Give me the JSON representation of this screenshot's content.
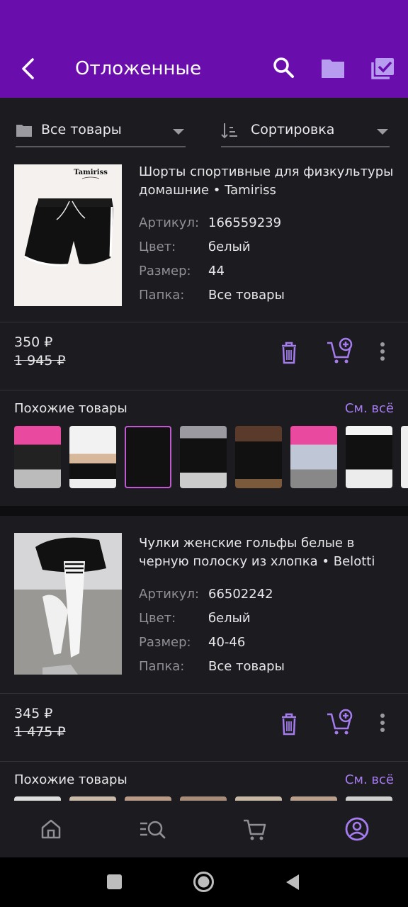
{
  "header": {
    "title": "Отложенные",
    "back_icon": "arrow-back-icon",
    "actions": [
      "search-icon",
      "folder-icon",
      "select-all-icon"
    ],
    "bg_color": "#6a0dad"
  },
  "filters": {
    "folder": {
      "label": "Все товары",
      "icon": "folder-icon"
    },
    "sort": {
      "label": "Сортировка",
      "icon": "sort-icon"
    }
  },
  "products": [
    {
      "title": "Шорты спортивные для физкультуры домашние • Tamiriss",
      "image_brand": "Tamiriss",
      "details": [
        {
          "key": "Артикул:",
          "value": "166559239"
        },
        {
          "key": "Цвет:",
          "value": "белый"
        },
        {
          "key": "Размер:",
          "value": "44"
        },
        {
          "key": "Папка:",
          "value": "Все товары"
        }
      ],
      "price": "350 ₽",
      "old_price": "1 945 ₽",
      "similar": {
        "title": "Похожие товары",
        "see_all": "См. всё"
      }
    },
    {
      "title": "Чулки женские гольфы белые в черную полоску из хлопка • Belotti",
      "details": [
        {
          "key": "Артикул:",
          "value": "66502242"
        },
        {
          "key": "Цвет:",
          "value": "белый"
        },
        {
          "key": "Размер:",
          "value": "40-46"
        },
        {
          "key": "Папка:",
          "value": "Все товары"
        }
      ],
      "price": "345 ₽",
      "old_price": "1 475 ₽",
      "similar": {
        "title": "Похожие товары",
        "see_all": "См. всё"
      }
    }
  ],
  "bottom_nav": [
    "home-icon",
    "catalog-search-icon",
    "cart-icon",
    "profile-icon"
  ],
  "accent_color": "#a57cf0"
}
